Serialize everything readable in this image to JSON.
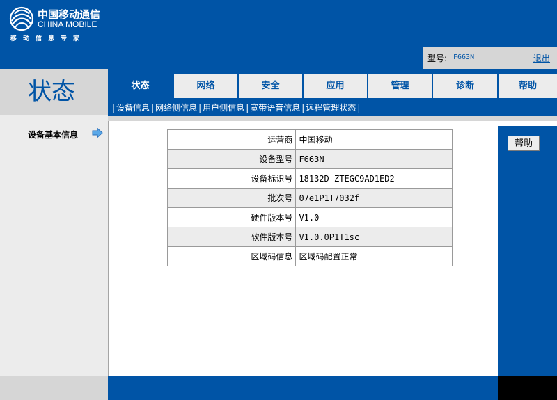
{
  "header": {
    "logo_cn": "中国移动通信",
    "logo_en": "CHINA MOBILE",
    "slogan": "移动信息专家"
  },
  "page_title": "状态",
  "top_bar": {
    "model_label": "型号:",
    "model_value": "F663N",
    "logout_label": "退出"
  },
  "tabs": [
    {
      "label": "状态",
      "active": true
    },
    {
      "label": "网络",
      "active": false
    },
    {
      "label": "安全",
      "active": false
    },
    {
      "label": "应用",
      "active": false
    },
    {
      "label": "管理",
      "active": false
    },
    {
      "label": "诊断",
      "active": false
    },
    {
      "label": "帮助",
      "active": false
    }
  ],
  "subnav": [
    {
      "label": "设备信息",
      "active": true
    },
    {
      "label": "网络侧信息",
      "active": false
    },
    {
      "label": "用户侧信息",
      "active": false
    },
    {
      "label": "宽带语音信息",
      "active": false
    },
    {
      "label": "远程管理状态",
      "active": false
    }
  ],
  "sidebar": {
    "section_label": "设备基本信息"
  },
  "device_info": [
    {
      "key": "运营商",
      "value": "中国移动"
    },
    {
      "key": "设备型号",
      "value": "F663N"
    },
    {
      "key": "设备标识号",
      "value": "18132D-ZTEGC9AD1ED2"
    },
    {
      "key": "批次号",
      "value": "07e1P1T7032f"
    },
    {
      "key": "硬件版本号",
      "value": "V1.0"
    },
    {
      "key": "软件版本号",
      "value": "V1.0.0P1T1sc"
    },
    {
      "key": "区域码信息",
      "value": "区域码配置正常"
    }
  ],
  "help_button_label": "帮助",
  "colors": {
    "brand_blue": "#0054a6",
    "panel_gray": "#d6d6d6",
    "light_gray": "#ececec"
  }
}
